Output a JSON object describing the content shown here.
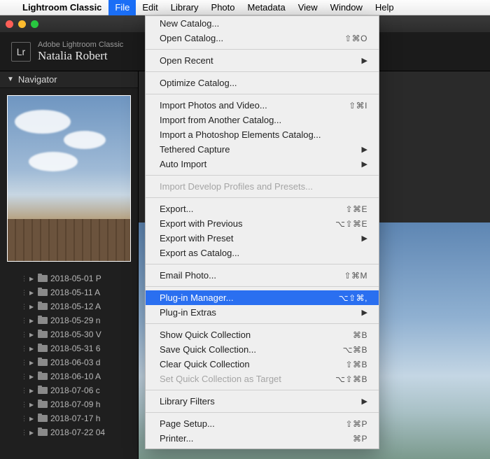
{
  "menubar": {
    "apple_glyph": "",
    "app_name": "Lightroom Classic",
    "items": [
      "File",
      "Edit",
      "Library",
      "Photo",
      "Metadata",
      "View",
      "Window",
      "Help"
    ],
    "open_index": 0
  },
  "file_menu": [
    {
      "type": "item",
      "label": "New Catalog..."
    },
    {
      "type": "item",
      "label": "Open Catalog...",
      "shortcut": "⇧⌘O"
    },
    {
      "type": "sep"
    },
    {
      "type": "item",
      "label": "Open Recent",
      "submenu": true
    },
    {
      "type": "sep"
    },
    {
      "type": "item",
      "label": "Optimize Catalog..."
    },
    {
      "type": "sep"
    },
    {
      "type": "item",
      "label": "Import Photos and Video...",
      "shortcut": "⇧⌘I"
    },
    {
      "type": "item",
      "label": "Import from Another Catalog..."
    },
    {
      "type": "item",
      "label": "Import a Photoshop Elements Catalog..."
    },
    {
      "type": "item",
      "label": "Tethered Capture",
      "submenu": true
    },
    {
      "type": "item",
      "label": "Auto Import",
      "submenu": true
    },
    {
      "type": "sep"
    },
    {
      "type": "item",
      "label": "Import Develop Profiles and Presets...",
      "disabled": true
    },
    {
      "type": "sep"
    },
    {
      "type": "item",
      "label": "Export...",
      "shortcut": "⇧⌘E"
    },
    {
      "type": "item",
      "label": "Export with Previous",
      "shortcut": "⌥⇧⌘E"
    },
    {
      "type": "item",
      "label": "Export with Preset",
      "submenu": true
    },
    {
      "type": "item",
      "label": "Export as Catalog..."
    },
    {
      "type": "sep"
    },
    {
      "type": "item",
      "label": "Email Photo...",
      "shortcut": "⇧⌘M"
    },
    {
      "type": "sep"
    },
    {
      "type": "item",
      "label": "Plug-in Manager...",
      "shortcut": "⌥⇧⌘,",
      "highlight": true
    },
    {
      "type": "item",
      "label": "Plug-in Extras",
      "submenu": true
    },
    {
      "type": "sep"
    },
    {
      "type": "item",
      "label": "Show Quick Collection",
      "shortcut": "⌘B"
    },
    {
      "type": "item",
      "label": "Save Quick Collection...",
      "shortcut": "⌥⌘B"
    },
    {
      "type": "item",
      "label": "Clear Quick Collection",
      "shortcut": "⇧⌘B"
    },
    {
      "type": "item",
      "label": "Set Quick Collection as Target",
      "shortcut": "⌥⇧⌘B",
      "disabled": true
    },
    {
      "type": "sep"
    },
    {
      "type": "item",
      "label": "Library Filters",
      "submenu": true
    },
    {
      "type": "sep"
    },
    {
      "type": "item",
      "label": "Page Setup...",
      "shortcut": "⇧⌘P"
    },
    {
      "type": "item",
      "label": "Printer...",
      "shortcut": "⌘P"
    }
  ],
  "lr": {
    "logo_text": "Lr",
    "product_line": "Adobe Lightroom Classic",
    "username": "Natalia Robert",
    "navigator_title": "Navigator"
  },
  "folders": [
    "2018-05-01 P",
    "2018-05-11 A",
    "2018-05-12 A",
    "2018-05-29 n",
    "2018-05-30 V",
    "2018-05-31 6",
    "2018-06-03 d",
    "2018-06-10 A",
    "2018-07-06 c",
    "2018-07-09 h",
    "2018-07-17 h",
    "2018-07-22 04"
  ]
}
